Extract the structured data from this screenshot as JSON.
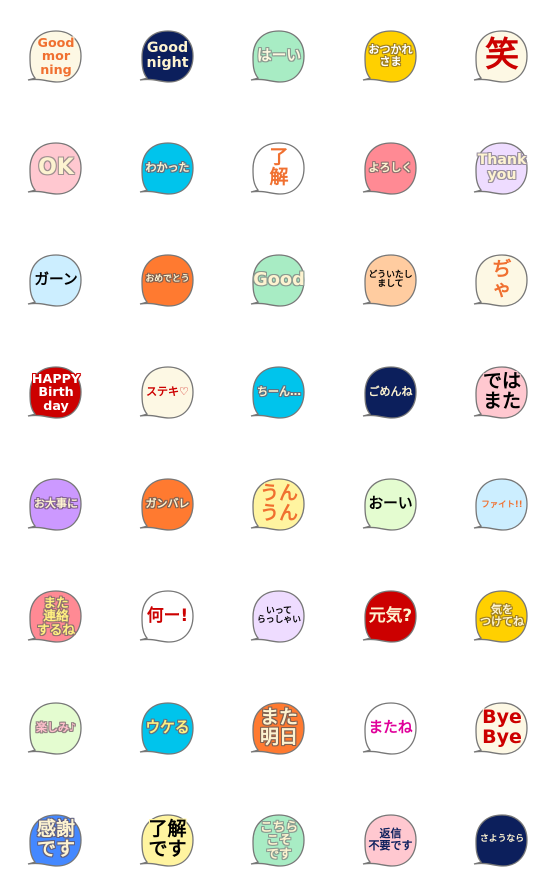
{
  "stickers": [
    {
      "lines": [
        "Good",
        "mor",
        "ning"
      ],
      "bg": "#fdf8e4",
      "fg": "#f07030",
      "halo": "#fdf8e4"
    },
    {
      "lines": [
        "Good",
        "night"
      ],
      "bg": "#0c1f5c",
      "fg": "#fdf3d0",
      "halo": "#0c1f5c"
    },
    {
      "lines": [
        "はーい"
      ],
      "bg": "#a8ecc4",
      "fg": "#fdf8e0",
      "halo": "#8a9a90"
    },
    {
      "lines": [
        "おつかれ",
        "さま"
      ],
      "bg": "#ffd000",
      "fg": "#ffffff",
      "halo": "#a08020"
    },
    {
      "lines": [
        "笑"
      ],
      "bg": "#fdf8e4",
      "fg": "#cc0000",
      "halo": "#fdf8e4"
    },
    {
      "lines": [
        "OK"
      ],
      "bg": "#ffc8d0",
      "fg": "#fdf3d0",
      "halo": "#a09090"
    },
    {
      "lines": [
        "わかった"
      ],
      "bg": "#00c4ec",
      "fg": "#fdf3d0",
      "halo": "#607080"
    },
    {
      "lines": [
        "了",
        "解"
      ],
      "bg": "#ffffff",
      "fg": "#f07030",
      "halo": "#ffffff"
    },
    {
      "lines": [
        "よろしく"
      ],
      "bg": "#ff8a94",
      "fg": "#fdf3d0",
      "halo": "#907070"
    },
    {
      "lines": [
        "Thank",
        "you"
      ],
      "bg": "#eedcff",
      "fg": "#fdf3d0",
      "halo": "#9a90a0"
    },
    {
      "lines": [
        "ガーン"
      ],
      "bg": "#cceeff",
      "fg": "#000000",
      "halo": "#cceeff"
    },
    {
      "lines": [
        "おめでとう"
      ],
      "bg": "#ff7a30",
      "fg": "#fdf3d0",
      "halo": "#806050"
    },
    {
      "lines": [
        "Good"
      ],
      "bg": "#a8ecc4",
      "fg": "#fdf3d0",
      "halo": "#8a9a90"
    },
    {
      "lines": [
        "どういたし",
        "まして"
      ],
      "bg": "#ffcca0",
      "fg": "#000000",
      "halo": "#ffcca0"
    },
    {
      "lines": [
        "ぢ",
        "ゃ"
      ],
      "bg": "#fdf8e4",
      "fg": "#f07030",
      "halo": "#fdf8e4"
    },
    {
      "lines": [
        "HAPPY",
        "Birth",
        "day"
      ],
      "bg": "#cc0000",
      "fg": "#ffffff",
      "halo": "#cc0000"
    },
    {
      "lines": [
        "ステキ♡"
      ],
      "bg": "#fdf8e4",
      "fg": "#cc0000",
      "halo": "#fdf8e4"
    },
    {
      "lines": [
        "ちーん…"
      ],
      "bg": "#00c4ec",
      "fg": "#fdf3d0",
      "halo": "#607080"
    },
    {
      "lines": [
        "ごめんね"
      ],
      "bg": "#0c1f5c",
      "fg": "#fdf3d0",
      "halo": "#0c1f5c"
    },
    {
      "lines": [
        "では",
        "また"
      ],
      "bg": "#ffc8d0",
      "fg": "#000000",
      "halo": "#ffc8d0"
    },
    {
      "lines": [
        "お大事に"
      ],
      "bg": "#cc99ff",
      "fg": "#fdf3d0",
      "halo": "#806090"
    },
    {
      "lines": [
        "ガンバレ"
      ],
      "bg": "#ff7a30",
      "fg": "#fdf3d0",
      "halo": "#806050"
    },
    {
      "lines": [
        "うん",
        "うん"
      ],
      "bg": "#fff4a0",
      "fg": "#f07030",
      "halo": "#fff4a0"
    },
    {
      "lines": [
        "おーい"
      ],
      "bg": "#e4fcd0",
      "fg": "#000000",
      "halo": "#e4fcd0"
    },
    {
      "lines": [
        "ファイト!!"
      ],
      "bg": "#cceeff",
      "fg": "#f07030",
      "halo": "#cceeff"
    },
    {
      "lines": [
        "また",
        "連絡",
        "するね"
      ],
      "bg": "#ff8a94",
      "fg": "#fff080",
      "halo": "#907070"
    },
    {
      "lines": [
        "何ー!"
      ],
      "bg": "#ffffff",
      "fg": "#cc0000",
      "halo": "#ffffff"
    },
    {
      "lines": [
        "いって",
        "らっしゃい"
      ],
      "bg": "#eedcff",
      "fg": "#000000",
      "halo": "#eedcff"
    },
    {
      "lines": [
        "元気?"
      ],
      "bg": "#cc0000",
      "fg": "#fdf3d0",
      "halo": "#cc0000"
    },
    {
      "lines": [
        "気を",
        "つけてね"
      ],
      "bg": "#ffd000",
      "fg": "#fdf3d0",
      "halo": "#a08020"
    },
    {
      "lines": [
        "楽しみ♪"
      ],
      "bg": "#e4fcd0",
      "fg": "#ffc0cc",
      "halo": "#908080"
    },
    {
      "lines": [
        "ウケる"
      ],
      "bg": "#00c4ec",
      "fg": "#fff080",
      "halo": "#607080"
    },
    {
      "lines": [
        "また",
        "明日"
      ],
      "bg": "#ff7a30",
      "fg": "#fdf3d0",
      "halo": "#806050"
    },
    {
      "lines": [
        "またね"
      ],
      "bg": "#ffffff",
      "fg": "#e0009a",
      "halo": "#ffffff"
    },
    {
      "lines": [
        "Bye",
        "Bye"
      ],
      "bg": "#fdf8e4",
      "fg": "#cc0000",
      "halo": "#fdf8e4"
    },
    {
      "lines": [
        "感謝",
        "です"
      ],
      "bg": "#4488ff",
      "fg": "#fdf3d0",
      "halo": "#606080"
    },
    {
      "lines": [
        "了解",
        "です"
      ],
      "bg": "#fff4a0",
      "fg": "#000000",
      "halo": "#fff4a0"
    },
    {
      "lines": [
        "こちら",
        "こそ",
        "です"
      ],
      "bg": "#a8ecc4",
      "fg": "#fdf3d0",
      "halo": "#8a9a90"
    },
    {
      "lines": [
        "返信",
        "不要です"
      ],
      "bg": "#ffc8d0",
      "fg": "#0c1f5c",
      "halo": "#ffc8d0"
    },
    {
      "lines": [
        "さようなら"
      ],
      "bg": "#0c1f5c",
      "fg": "#fdf3d0",
      "halo": "#0c1f5c"
    }
  ],
  "outline_color": "#777777"
}
